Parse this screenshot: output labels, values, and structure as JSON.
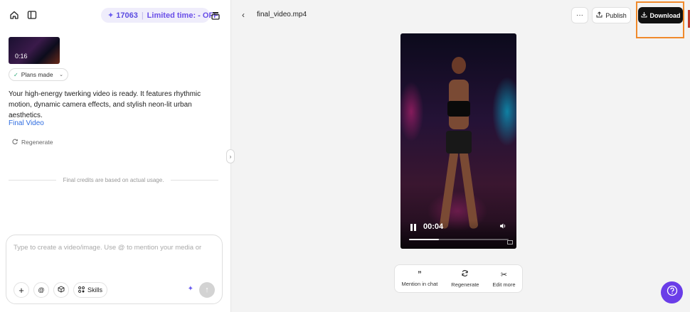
{
  "sidebar": {
    "credits": "17063",
    "promo": "Limited time: - OFF",
    "thumbnail_duration": "0:16",
    "plans_label": "Plans made",
    "message": "Your high-energy twerking video is ready. It features rhythmic motion, dynamic camera effects, and stylish neon-lit urban aesthetics.",
    "final_video_link": "Final Video",
    "regenerate_label": "Regenerate",
    "credits_note": "Final credits are based on actual usage.",
    "chat": {
      "placeholder": "Type to create a video/image. Use @ to mention your media or",
      "at_label": "@",
      "skills_label": "Skills"
    }
  },
  "viewer": {
    "filename": "final_video.mp4",
    "more_label": "···",
    "publish_label": "Publish",
    "download_label": "Download",
    "current_time": "00:04",
    "progress": 0.3,
    "actions": [
      {
        "label": "Mention in chat",
        "icon": "quote-icon"
      },
      {
        "label": "Regenerate",
        "icon": "refresh-icon"
      },
      {
        "label": "Edit more",
        "icon": "scissors-icon"
      }
    ]
  },
  "colors": {
    "accent": "#6a3de8",
    "highlight": "#f08a2c",
    "link": "#2f6de0"
  }
}
